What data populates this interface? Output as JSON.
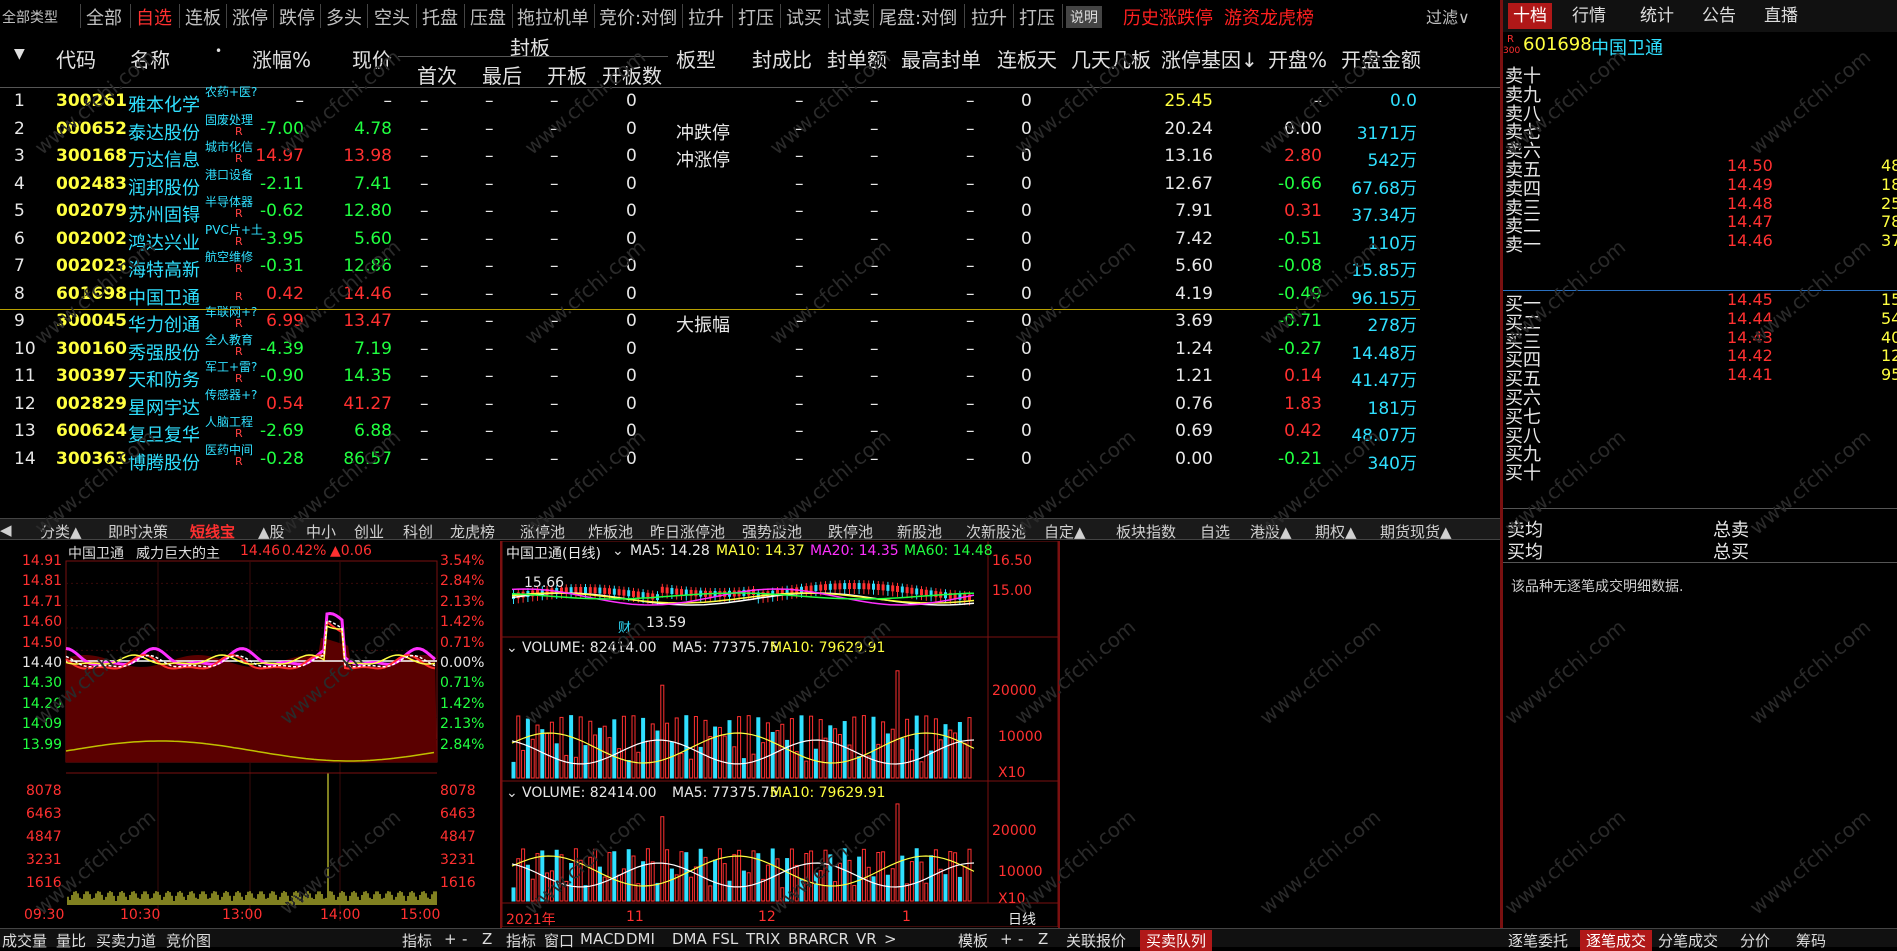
{
  "topbar": {
    "items": [
      "全部类型",
      "全部",
      "自选",
      "连板",
      "涨停",
      "跌停",
      "多头",
      "空头",
      "托盘",
      "压盘",
      "拖拉机单",
      "竞价:对倒",
      "拉升",
      "打压",
      "试买",
      "试卖",
      "尾盘:对倒",
      "拉升",
      "打压"
    ],
    "selected_index": 2,
    "explain_btn": "说明",
    "history_link": "历史涨跌停",
    "hot_money_link": "游资龙虎榜",
    "filter_label": "过滤∨"
  },
  "right_tabs": [
    "十档",
    "行情",
    "统计",
    "公告",
    "直播"
  ],
  "quote": {
    "badge_r": "R",
    "badge_300": "300",
    "code": "601698",
    "name": "中国卫通",
    "sell_labels": [
      "卖十",
      "卖九",
      "卖八",
      "卖七",
      "卖六",
      "卖五",
      "卖四",
      "卖三",
      "卖二",
      "卖一"
    ],
    "sell_prices": [
      "",
      "",
      "",
      "",
      "",
      "14.50",
      "14.49",
      "14.48",
      "14.47",
      "14.46"
    ],
    "sell_vols": [
      "",
      "",
      "",
      "",
      "",
      "48",
      "18",
      "25",
      "78",
      "37"
    ],
    "buy_labels": [
      "买一",
      "买二",
      "买三",
      "买四",
      "买五",
      "买六",
      "买七",
      "买八",
      "买九",
      "买十"
    ],
    "buy_prices": [
      "14.45",
      "14.44",
      "14.43",
      "14.42",
      "14.41",
      "",
      "",
      "",
      "",
      ""
    ],
    "buy_vols": [
      "15",
      "54",
      "40",
      "12",
      "95",
      "",
      "",
      "",
      "",
      ""
    ],
    "avg_sell": "卖均",
    "total_sell": "总卖",
    "avg_buy": "买均",
    "total_buy": "总买",
    "no_tick": "该品种无逐笔成交明细数据."
  },
  "table": {
    "headers": {
      "code": "代码",
      "name": "名称",
      "dot": "•",
      "chg": "涨幅%",
      "price": "现价",
      "seal": "封板",
      "first": "首次",
      "last": "最后",
      "openb": "开板",
      "opencnt": "开板数",
      "plate": "板型",
      "ratio": "封成比",
      "amt": "封单额",
      "maxamt": "最高封单",
      "days": "连板天",
      "nday": "几天几板",
      "gene": "涨停基因↓",
      "openpct": "开盘%",
      "openamt": "开盘金额"
    },
    "rows": [
      {
        "i": "1",
        "code": "300261",
        "name": "雅本化学",
        "tag": "农药+医?",
        "r": "",
        "chg": "–",
        "price": "–",
        "first": "–",
        "last": "–",
        "openb": "–",
        "cnt": "0",
        "plate": "",
        "ratio": "–",
        "amt": "–",
        "maxamt": "–",
        "days": "0",
        "gene": "25.45",
        "openpct": "–",
        "openamt": "0.0",
        "chgc": "wt",
        "pricec": "wt",
        "openc": "wt"
      },
      {
        "i": "2",
        "code": "000652",
        "name": "泰达股份",
        "tag": "固废处理",
        "r": "R",
        "chg": "-7.00",
        "price": "4.78",
        "first": "–",
        "last": "–",
        "openb": "–",
        "cnt": "0",
        "plate": "冲跌停",
        "ratio": "–",
        "amt": "–",
        "maxamt": "–",
        "days": "0",
        "gene": "20.24",
        "openpct": "0.00",
        "openamt": "3171万",
        "chgc": "gn",
        "pricec": "gn",
        "openc": "wt"
      },
      {
        "i": "3",
        "code": "300168",
        "name": "万达信息",
        "tag": "城市化信",
        "r": "R",
        "chg": "14.97",
        "price": "13.98",
        "first": "–",
        "last": "–",
        "openb": "–",
        "cnt": "0",
        "plate": "冲涨停",
        "ratio": "–",
        "amt": "–",
        "maxamt": "–",
        "days": "0",
        "gene": "13.16",
        "openpct": "2.80",
        "openamt": "542万",
        "chgc": "rd",
        "pricec": "rd",
        "openc": "rd"
      },
      {
        "i": "4",
        "code": "002483",
        "name": "润邦股份",
        "tag": "港口设备",
        "r": "",
        "chg": "-2.11",
        "price": "7.41",
        "first": "–",
        "last": "–",
        "openb": "–",
        "cnt": "0",
        "plate": "",
        "ratio": "–",
        "amt": "–",
        "maxamt": "–",
        "days": "0",
        "gene": "12.67",
        "openpct": "-0.66",
        "openamt": "67.68万",
        "chgc": "gn",
        "pricec": "gn",
        "openc": "gn"
      },
      {
        "i": "5",
        "code": "002079",
        "name": "苏州固锝",
        "tag": "半导体器",
        "r": "R",
        "chg": "-0.62",
        "price": "12.80",
        "first": "–",
        "last": "–",
        "openb": "–",
        "cnt": "0",
        "plate": "",
        "ratio": "–",
        "amt": "–",
        "maxamt": "–",
        "days": "0",
        "gene": "7.91",
        "openpct": "0.31",
        "openamt": "37.34万",
        "chgc": "gn",
        "pricec": "gn",
        "openc": "rd"
      },
      {
        "i": "6",
        "code": "002002",
        "name": "鸿达兴业",
        "tag": "PVC片+土",
        "r": "R",
        "chg": "-3.95",
        "price": "5.60",
        "first": "–",
        "last": "–",
        "openb": "–",
        "cnt": "0",
        "plate": "",
        "ratio": "–",
        "amt": "–",
        "maxamt": "–",
        "days": "0",
        "gene": "7.42",
        "openpct": "-0.51",
        "openamt": "110万",
        "chgc": "gn",
        "pricec": "gn",
        "openc": "gn"
      },
      {
        "i": "7",
        "code": "002023",
        "name": "海特高新",
        "tag": "航空维修",
        "r": "R",
        "chg": "-0.31",
        "price": "12.86",
        "first": "–",
        "last": "–",
        "openb": "–",
        "cnt": "0",
        "plate": "",
        "ratio": "–",
        "amt": "–",
        "maxamt": "–",
        "days": "0",
        "gene": "5.60",
        "openpct": "-0.08",
        "openamt": "15.85万",
        "chgc": "gn",
        "pricec": "gn",
        "openc": "gn"
      },
      {
        "i": "8",
        "code": "601698",
        "name": "中国卫通",
        "tag": "",
        "r": "R",
        "chg": "0.42",
        "price": "14.46",
        "first": "–",
        "last": "–",
        "openb": "–",
        "cnt": "0",
        "plate": "",
        "ratio": "–",
        "amt": "–",
        "maxamt": "–",
        "days": "0",
        "gene": "4.19",
        "openpct": "-0.49",
        "openamt": "96.15万",
        "chgc": "rd",
        "pricec": "rd",
        "openc": "gn"
      },
      {
        "i": "9",
        "code": "300045",
        "name": "华力创通",
        "tag": "车联网+?",
        "r": "R",
        "chg": "6.99",
        "price": "13.47",
        "first": "–",
        "last": "–",
        "openb": "–",
        "cnt": "0",
        "plate": "大振幅",
        "ratio": "–",
        "amt": "–",
        "maxamt": "–",
        "days": "0",
        "gene": "3.69",
        "openpct": "-0.71",
        "openamt": "278万",
        "chgc": "rd",
        "pricec": "rd",
        "openc": "gn"
      },
      {
        "i": "10",
        "code": "300160",
        "name": "秀强股份",
        "tag": "全人教育",
        "r": "R",
        "chg": "-4.39",
        "price": "7.19",
        "first": "–",
        "last": "–",
        "openb": "–",
        "cnt": "0",
        "plate": "",
        "ratio": "–",
        "amt": "–",
        "maxamt": "–",
        "days": "0",
        "gene": "1.24",
        "openpct": "-0.27",
        "openamt": "14.48万",
        "chgc": "gn",
        "pricec": "gn",
        "openc": "gn"
      },
      {
        "i": "11",
        "code": "300397",
        "name": "天和防务",
        "tag": "军工+雷?",
        "r": "R",
        "chg": "-0.90",
        "price": "14.35",
        "first": "–",
        "last": "–",
        "openb": "–",
        "cnt": "0",
        "plate": "",
        "ratio": "–",
        "amt": "–",
        "maxamt": "–",
        "days": "0",
        "gene": "1.21",
        "openpct": "0.14",
        "openamt": "41.47万",
        "chgc": "gn",
        "pricec": "gn",
        "openc": "rd"
      },
      {
        "i": "12",
        "code": "002829",
        "name": "星网宇达",
        "tag": "传感器+?",
        "r": "",
        "chg": "0.54",
        "price": "41.27",
        "first": "–",
        "last": "–",
        "openb": "–",
        "cnt": "0",
        "plate": "",
        "ratio": "–",
        "amt": "–",
        "maxamt": "–",
        "days": "0",
        "gene": "0.76",
        "openpct": "1.83",
        "openamt": "181万",
        "chgc": "rd",
        "pricec": "rd",
        "openc": "rd"
      },
      {
        "i": "13",
        "code": "600624",
        "name": "复旦复华",
        "tag": "人脑工程",
        "r": "R",
        "chg": "-2.69",
        "price": "6.88",
        "first": "–",
        "last": "–",
        "openb": "–",
        "cnt": "0",
        "plate": "",
        "ratio": "–",
        "amt": "–",
        "maxamt": "–",
        "days": "0",
        "gene": "0.69",
        "openpct": "0.42",
        "openamt": "48.07万",
        "chgc": "gn",
        "pricec": "gn",
        "openc": "rd"
      },
      {
        "i": "14",
        "code": "300363",
        "name": "博腾股份",
        "tag": "医药中间",
        "r": "R",
        "chg": "-0.28",
        "price": "86.57",
        "first": "–",
        "last": "–",
        "openb": "–",
        "cnt": "0",
        "plate": "",
        "ratio": "–",
        "amt": "–",
        "maxamt": "–",
        "days": "0",
        "gene": "0.00",
        "openpct": "-0.21",
        "openamt": "340万",
        "chgc": "gn",
        "pricec": "gn",
        "openc": "gn"
      }
    ]
  },
  "bottom_tabs": [
    "分类▲",
    "即时决策",
    "短线宝",
    "▲股",
    "中小",
    "创业",
    "科创",
    "龙虎榜",
    "涨停池",
    "炸板池",
    "昨日涨停池",
    "强势股池",
    "跌停池",
    "新股池",
    "次新股池",
    "自定▲",
    "板块指数",
    "自选",
    "港股▲",
    "期权▲",
    "期货现货▲"
  ],
  "bottom_tab_selected": 2,
  "intraday": {
    "title": "中国卫通",
    "subtitle": "威力巨大的主",
    "price": "14.46",
    "pct": "0.42%",
    "delta": "▲0.06",
    "left_ticks": [
      "14.91",
      "14.81",
      "14.71",
      "14.60",
      "14.50",
      "14.40",
      "14.30",
      "14.20",
      "14.09",
      "13.99"
    ],
    "right_ticks": [
      "3.54%",
      "2.84%",
      "2.13%",
      "1.42%",
      "0.71%",
      "0.00%",
      "0.71%",
      "1.42%",
      "2.13%",
      "2.84%"
    ],
    "vol_ticks": [
      "8078",
      "6463",
      "4847",
      "3231",
      "1616"
    ],
    "time_ticks": [
      "09:30",
      "10:30",
      "13:00",
      "14:00",
      "15:00"
    ]
  },
  "daily": {
    "title": "中国卫通(日线)",
    "ma5": "MA5: 14.28",
    "ma10": "MA10: 14.37",
    "ma20": "MA20: 14.35",
    "ma60": "MA60: 14.48",
    "price_ticks": [
      "16.50",
      "15.00"
    ],
    "hi_label": "15.66",
    "lo_label": "13.59",
    "cai": "财",
    "vol1": {
      "label": "VOLUME: 82414.00",
      "ma5": "MA5: 77375.75",
      "ma10": "MA10: 79629.91",
      "ticks": [
        "20000",
        "10000"
      ],
      "unit": "X10"
    },
    "vol2": {
      "label": "VOLUME: 82414.00",
      "ma5": "MA5: 77375.75",
      "ma10": "MA10: 79629.91",
      "ticks": [
        "20000",
        "10000"
      ],
      "unit": "X10"
    },
    "date_ticks": [
      "2021年",
      "11",
      "12",
      "1"
    ],
    "period": "日线"
  },
  "status_bar": {
    "left": [
      "成交量",
      "量比",
      "买卖力道",
      "竞价图"
    ],
    "mid_a": [
      "指标",
      "+",
      "-",
      "Z"
    ],
    "mid_b": [
      "指标",
      "窗口",
      "MACD",
      "DMI",
      "DMA",
      "FSL",
      "TRIX",
      "BRAR",
      "CR",
      "VR",
      ">"
    ],
    "mid_c": [
      "模板",
      "+",
      "-",
      "Z"
    ],
    "right_a": [
      "关联报价",
      "买卖队列"
    ],
    "right_b": [
      "逐笔委托",
      "逐笔成交",
      "分笔成交",
      "分价",
      "筹码"
    ]
  },
  "colors": {
    "bg": "#000000",
    "red": "#ff3030",
    "green": "#20ff40",
    "cyan": "#30e0ff",
    "yellow": "#ffff40",
    "magenta": "#ff30ff"
  }
}
